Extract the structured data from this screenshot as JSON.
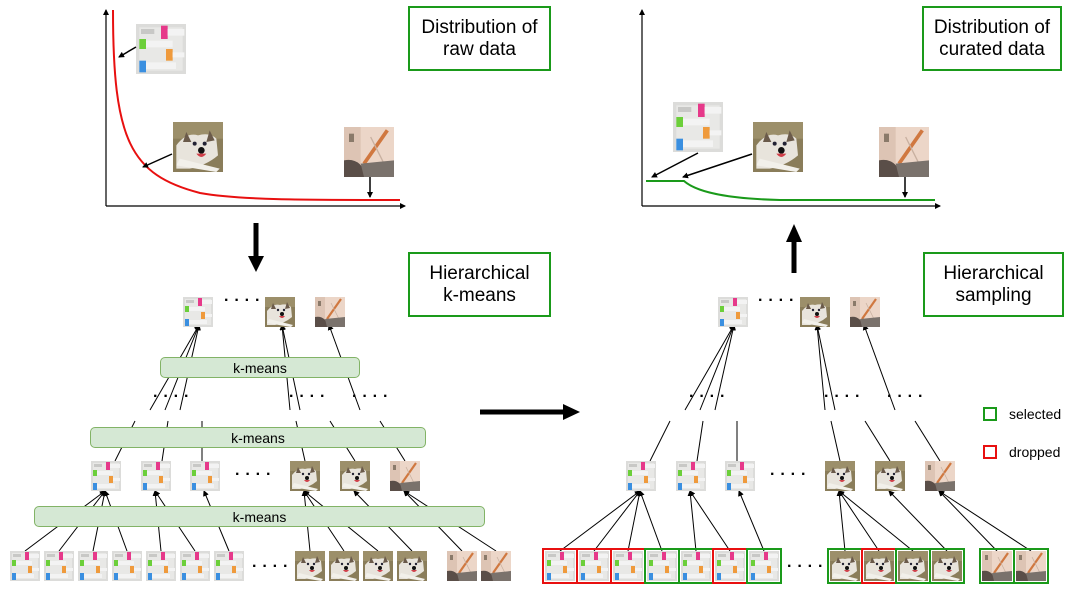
{
  "labels": {
    "raw_distribution": "Distribution of raw data",
    "raw_distribution_line1": "Distribution of",
    "raw_distribution_line2": "raw data",
    "curated_distribution_line1": "Distribution of",
    "curated_distribution_line2": "curated data",
    "kmeans_title_line1": "Hierarchical",
    "kmeans_title_line2": "k-means",
    "sampling_title_line1": "Hierarchical",
    "sampling_title_line2": "sampling",
    "kmeans_bar": "k-means",
    "ellipsis": "····"
  },
  "legend": [
    {
      "label": "selected",
      "color": "#1a9a1a"
    },
    {
      "label": "dropped",
      "color": "#e81010"
    }
  ],
  "colors": {
    "raw_curve": "#e81010",
    "curated_curve": "#1a9a1a",
    "box_border": "#1a9a1a",
    "kmeans_fill": "#d5e8d4",
    "kmeans_border": "#82b366"
  },
  "image_kinds": [
    "screenshot",
    "dog",
    "plunger"
  ],
  "left_tree": {
    "top": [
      "screenshot",
      "dog",
      "plunger"
    ],
    "mid": [
      "screenshot",
      "screenshot",
      "screenshot",
      "dog",
      "dog",
      "plunger"
    ],
    "bottom": [
      "screenshot",
      "screenshot",
      "screenshot",
      "screenshot",
      "screenshot",
      "screenshot",
      "screenshot",
      "dog",
      "dog",
      "dog",
      "dog",
      "plunger",
      "plunger"
    ]
  },
  "right_tree": {
    "top": [
      "screenshot",
      "dog",
      "plunger"
    ],
    "mid": [
      "screenshot",
      "screenshot",
      "screenshot",
      "dog",
      "dog",
      "plunger"
    ],
    "bottom": [
      {
        "kind": "screenshot",
        "status": "dropped"
      },
      {
        "kind": "screenshot",
        "status": "dropped"
      },
      {
        "kind": "screenshot",
        "status": "dropped"
      },
      {
        "kind": "screenshot",
        "status": "selected"
      },
      {
        "kind": "screenshot",
        "status": "selected"
      },
      {
        "kind": "screenshot",
        "status": "dropped"
      },
      {
        "kind": "screenshot",
        "status": "selected"
      },
      {
        "kind": "dog",
        "status": "selected"
      },
      {
        "kind": "dog",
        "status": "dropped"
      },
      {
        "kind": "dog",
        "status": "selected"
      },
      {
        "kind": "dog",
        "status": "selected"
      },
      {
        "kind": "plunger",
        "status": "selected"
      },
      {
        "kind": "plunger",
        "status": "selected"
      }
    ]
  }
}
